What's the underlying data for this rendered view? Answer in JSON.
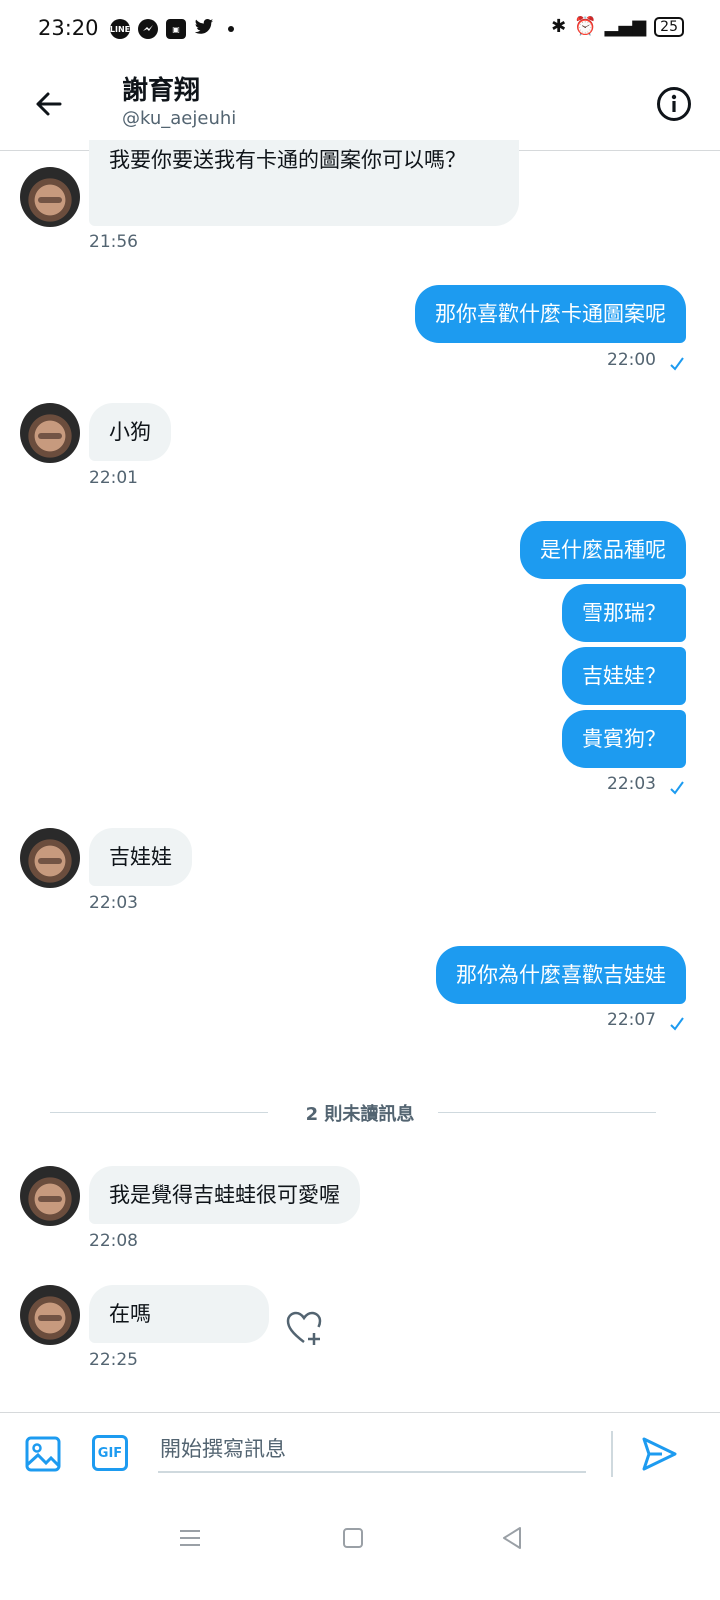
{
  "status_bar": {
    "time": "23:20",
    "notification_icons": [
      "line-icon",
      "messenger-icon",
      "app-icon",
      "twitter-icon"
    ],
    "battery": "25"
  },
  "header": {
    "title": "謝育翔",
    "handle": "@ku_aejeuhi"
  },
  "messages": [
    {
      "from": "them",
      "text": "我要你要送我有卡通的圖案你可以嗎？",
      "time": "21:56"
    },
    {
      "from": "me",
      "text": "那你喜歡什麼卡通圖案呢",
      "time": "22:00",
      "read": true
    },
    {
      "from": "them",
      "text": "小狗",
      "time": "22:01"
    },
    {
      "from": "me",
      "text": "是什麼品種呢"
    },
    {
      "from": "me",
      "text": "雪那瑞？"
    },
    {
      "from": "me",
      "text": "吉娃娃？"
    },
    {
      "from": "me",
      "text": "貴賓狗？",
      "time": "22:03",
      "read": true
    },
    {
      "from": "them",
      "text": "吉娃娃",
      "time": "22:03"
    },
    {
      "from": "me",
      "text": "那你為什麼喜歡吉娃娃",
      "time": "22:07",
      "read": true
    },
    {
      "from": "them",
      "text": "我是覺得吉蛙蛙很可愛喔",
      "time": "22:08"
    },
    {
      "from": "them",
      "text": "在嗎",
      "time": "22:25"
    }
  ],
  "unread_divider": "2 則未讀訊息",
  "composer": {
    "placeholder": "開始撰寫訊息",
    "gif_label": "GIF"
  },
  "colors": {
    "accent": "#1d9bf0",
    "incoming_bubble": "#eff3f4",
    "secondary_text": "#536471"
  }
}
